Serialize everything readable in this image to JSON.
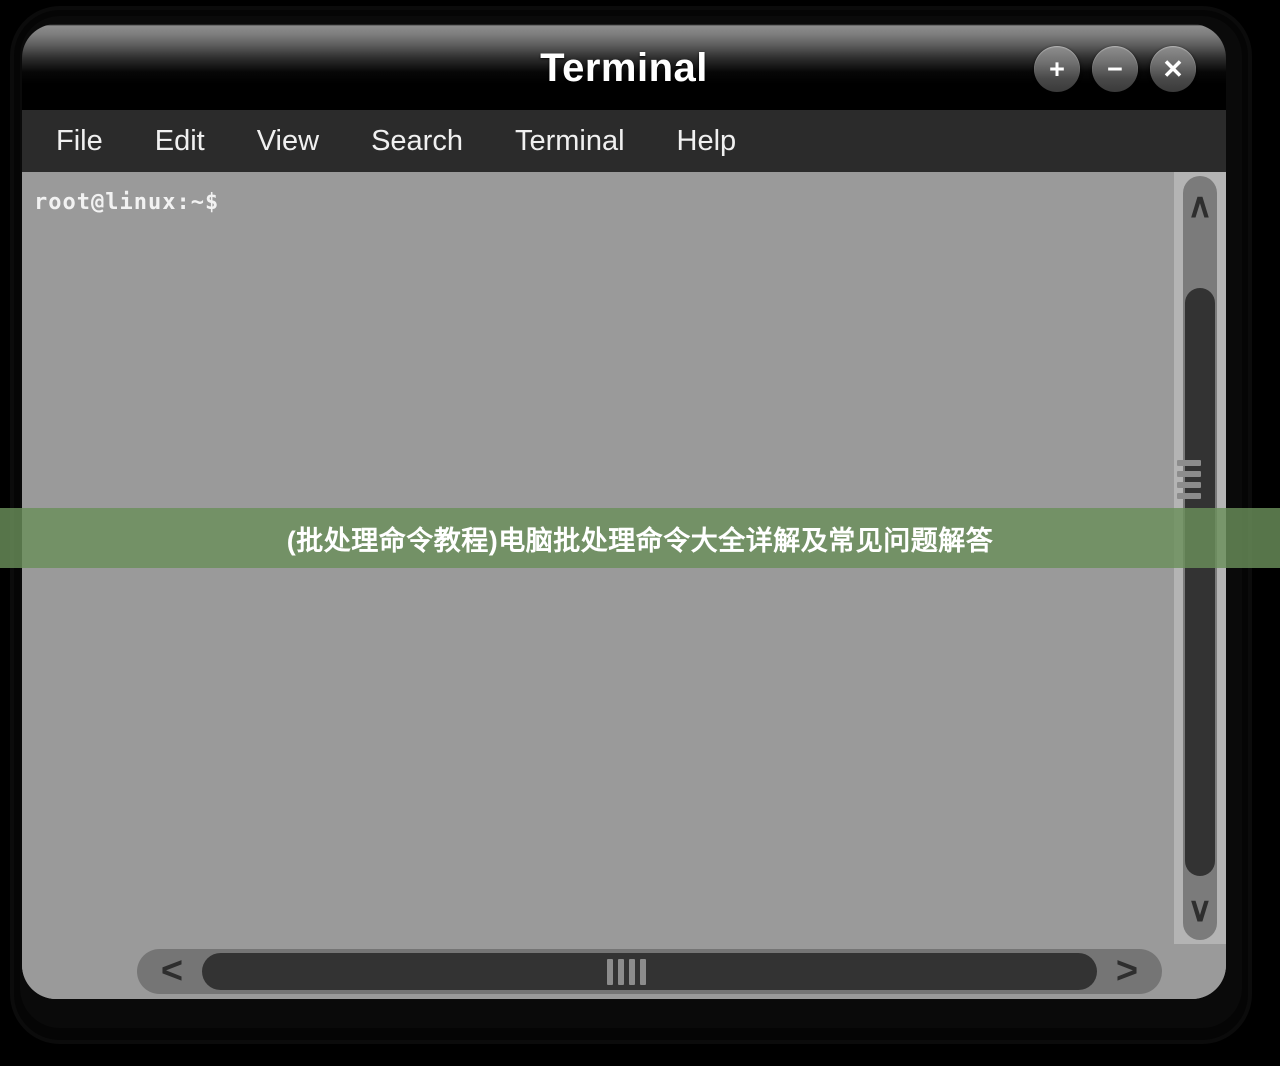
{
  "window": {
    "title": "Terminal",
    "controls": [
      {
        "name": "maximize-button",
        "glyph": "+"
      },
      {
        "name": "minimize-button",
        "glyph": "−"
      },
      {
        "name": "close-button",
        "glyph": "✕"
      }
    ]
  },
  "menubar": {
    "items": [
      {
        "label": "File"
      },
      {
        "label": "Edit"
      },
      {
        "label": "View"
      },
      {
        "label": "Search"
      },
      {
        "label": "Terminal"
      },
      {
        "label": "Help"
      }
    ]
  },
  "terminal": {
    "prompt": "root@linux:~$",
    "background_color": "#9a9a9a",
    "text_color": "#f2f2f2"
  },
  "scrollbars": {
    "vertical": {
      "up_arrow": "∧",
      "down_arrow": "∨",
      "grip_bars": 4
    },
    "horizontal": {
      "left_arrow": "<",
      "right_arrow": ">",
      "grip_bars": 4
    }
  },
  "banner": {
    "text": "(批处理命令教程)电脑批处理命令大全详解及常见问题解答",
    "background_color": "#6a8f5a",
    "text_color": "#ffffff"
  }
}
